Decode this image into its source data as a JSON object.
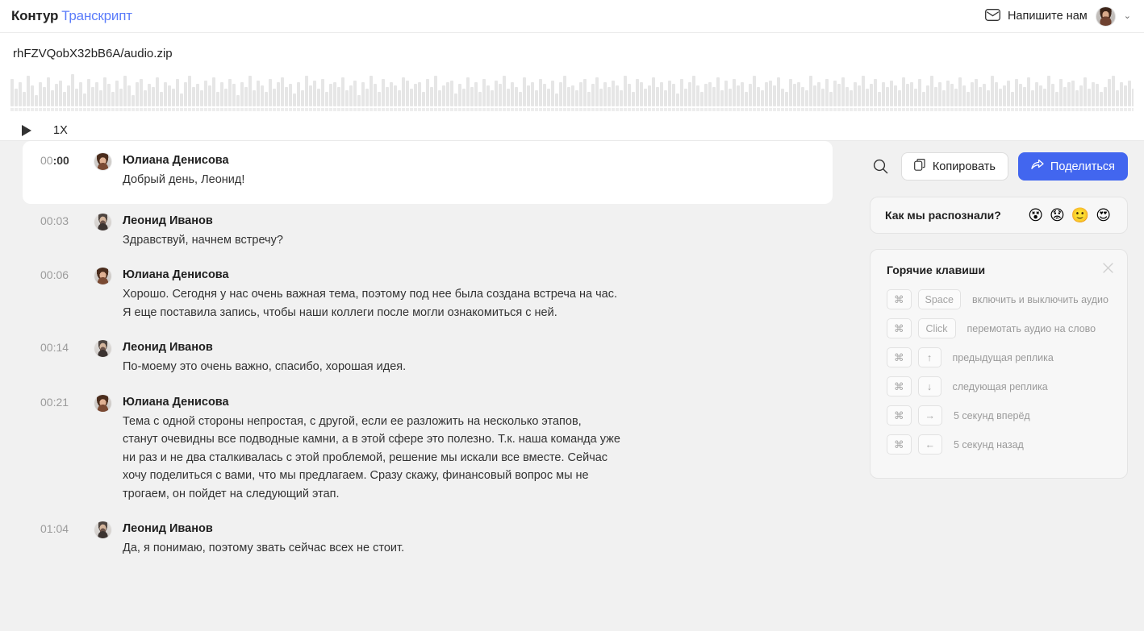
{
  "header": {
    "brand_primary": "Контур",
    "brand_secondary": "Транскрипт",
    "contact_label": "Напишите нам",
    "mail_icon": "envelope-icon",
    "avatar": "user-avatar",
    "chevron": "⌄"
  },
  "player": {
    "filename": "rhFZVQobX32bB6A/audio.zip",
    "play_icon": "play-icon",
    "speed": "1X",
    "waveform": [
      34,
      22,
      30,
      18,
      38,
      26,
      14,
      30,
      24,
      36,
      20,
      28,
      32,
      18,
      26,
      40,
      22,
      30,
      16,
      34,
      24,
      30,
      20,
      36,
      28,
      18,
      32,
      22,
      38,
      26,
      14,
      30,
      34,
      20,
      28,
      24,
      36,
      18,
      30,
      26,
      22,
      34,
      16,
      30,
      38,
      24,
      28,
      20,
      32,
      26,
      36,
      18,
      30,
      22,
      34,
      28,
      14,
      30,
      24,
      38,
      20,
      32,
      26,
      18,
      34,
      22,
      30,
      36,
      24,
      28,
      16,
      30,
      20,
      38,
      26,
      32,
      22,
      34,
      18,
      28,
      30,
      24,
      36,
      20,
      26,
      32,
      14,
      30,
      22,
      38,
      28,
      18,
      34,
      24,
      30,
      26,
      20,
      36,
      32,
      22,
      28,
      30,
      18,
      34,
      24,
      38,
      20,
      26,
      30,
      32,
      16,
      28,
      22,
      36,
      24,
      30,
      18,
      34,
      26,
      20,
      32,
      28,
      38,
      22,
      30,
      24,
      18,
      36,
      26,
      30,
      20,
      34,
      28,
      22,
      32,
      16,
      30,
      38,
      24,
      26,
      20,
      30,
      34,
      18,
      28,
      36,
      22,
      30,
      24,
      32,
      26,
      20,
      38,
      28,
      18,
      34,
      30,
      22,
      26,
      36,
      24,
      30,
      20,
      32,
      28,
      16,
      34,
      22,
      30,
      38,
      26,
      18,
      28,
      30,
      24,
      36,
      20,
      32,
      22,
      34,
      26,
      30,
      18,
      28,
      38,
      24,
      20,
      30,
      32,
      26,
      36,
      22,
      18,
      34,
      28,
      30,
      24,
      20,
      38,
      26,
      30,
      22,
      34,
      18,
      32,
      28,
      36,
      24,
      20,
      30,
      26,
      38,
      22,
      28,
      34,
      18,
      30,
      24,
      32,
      26,
      20,
      36,
      28,
      30,
      22,
      34,
      18,
      26,
      38,
      24,
      30,
      20,
      32,
      28,
      22,
      36,
      26,
      18,
      30,
      34,
      24,
      28,
      20,
      38,
      30,
      22,
      26,
      32,
      18,
      34,
      28,
      24,
      36,
      20,
      30,
      26,
      22,
      38,
      28,
      18,
      34,
      24,
      30,
      32,
      20,
      26,
      36,
      22,
      30,
      28,
      18,
      24,
      34,
      38,
      20,
      30,
      26,
      32,
      22,
      28,
      18,
      36,
      30,
      24,
      20,
      34,
      26,
      38,
      28,
      22,
      30,
      18,
      32,
      24,
      36,
      20,
      28,
      26,
      30,
      34,
      22,
      18,
      38,
      24,
      28,
      20,
      32,
      30,
      26,
      36,
      22,
      34,
      18,
      28,
      24,
      30,
      20,
      38,
      26,
      32,
      28,
      22,
      18,
      34,
      30,
      24,
      36,
      20,
      26,
      30,
      38,
      22,
      28,
      18,
      32,
      24,
      34,
      20,
      30,
      26
    ]
  },
  "transcript": [
    {
      "time": "00:00",
      "time_head": "00",
      "time_tail": ":00",
      "speaker": "Юлиана Денисова",
      "avatar": "female-avatar",
      "active": true,
      "lines": [
        "Добрый день, Леонид!"
      ]
    },
    {
      "time": "00:03",
      "speaker": "Леонид Иванов",
      "avatar": "male-avatar",
      "active": false,
      "lines": [
        "Здравствуй, начнем встречу?"
      ]
    },
    {
      "time": "00:06",
      "speaker": "Юлиана Денисова",
      "avatar": "female-avatar",
      "active": false,
      "lines": [
        "Хорошо. Сегодня у нас очень важная тема, поэтому под нее была создана встреча на час.",
        "Я еще поставила запись, чтобы наши коллеги после могли ознакомиться с ней."
      ]
    },
    {
      "time": "00:14",
      "speaker": "Леонид Иванов",
      "avatar": "male-avatar",
      "active": false,
      "lines": [
        "По-моему это очень важно, спасибо, хорошая идея."
      ]
    },
    {
      "time": "00:21",
      "speaker": "Юлиана Денисова",
      "avatar": "female-avatar",
      "active": false,
      "lines": [
        "Тема с одной стороны непростая, с другой, если ее разложить на несколько этапов,",
        "станут очевидны все подводные камни, а в этой сфере это полезно. Т.к. наша команда уже",
        "ни раз и не два сталкивалась с этой проблемой, решение мы искали все вместе. Сейчас",
        "хочу поделиться с вами, что мы предлагаем. Сразу скажу, финансовый вопрос мы не",
        "трогаем, он пойдет на следующий этап."
      ]
    },
    {
      "time": "01:04",
      "speaker": "Леонид Иванов",
      "avatar": "male-avatar",
      "active": false,
      "lines": [
        "Да, я понимаю, поэтому звать сейчас всех не стоит."
      ]
    }
  ],
  "sidebar": {
    "search_icon": "search-icon",
    "copy_label": "Копировать",
    "copy_icon": "copy-icon",
    "share_label": "Поделиться",
    "share_icon": "share-arrow-icon",
    "share_color": "#4266ef",
    "rating": {
      "label": "Как мы распознали?",
      "emojis": [
        "😵",
        "😟",
        "🙂",
        "😍"
      ]
    },
    "hotkeys": {
      "title": "Горячие клавиши",
      "close_icon": "close-icon",
      "rows": [
        {
          "mod": "⌘",
          "key": "Space",
          "wide": true,
          "desc": "включить и выключить аудио"
        },
        {
          "mod": "⌘",
          "key": "Click",
          "wide": true,
          "desc": "перемотать аудио на слово"
        },
        {
          "mod": "⌘",
          "key": "↑",
          "wide": false,
          "desc": "предыдущая реплика"
        },
        {
          "mod": "⌘",
          "key": "↓",
          "wide": false,
          "desc": "следующая реплика"
        },
        {
          "mod": "⌘",
          "key": "→",
          "wide": false,
          "desc": "5 секунд вперёд"
        },
        {
          "mod": "⌘",
          "key": "←",
          "wide": false,
          "desc": "5 секунд назад"
        }
      ]
    }
  }
}
